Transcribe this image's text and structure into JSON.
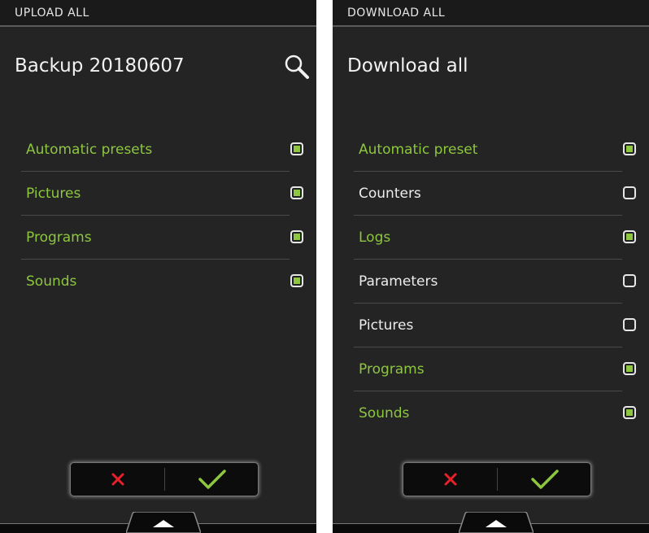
{
  "left": {
    "topbar_title": "UPLOAD ALL",
    "heading": "Backup 20180607",
    "search_icon": "search-icon",
    "items": [
      {
        "label": "Automatic presets",
        "checked": true
      },
      {
        "label": "Pictures",
        "checked": true
      },
      {
        "label": "Programs",
        "checked": true
      },
      {
        "label": "Sounds",
        "checked": true
      }
    ]
  },
  "right": {
    "topbar_title": "DOWNLOAD ALL",
    "heading": "Download all",
    "items": [
      {
        "label": "Automatic preset",
        "checked": true
      },
      {
        "label": "Counters",
        "checked": false
      },
      {
        "label": "Logs",
        "checked": true
      },
      {
        "label": "Parameters",
        "checked": false
      },
      {
        "label": "Pictures",
        "checked": false
      },
      {
        "label": "Programs",
        "checked": true
      },
      {
        "label": "Sounds",
        "checked": true
      }
    ]
  },
  "actions": {
    "cancel_icon": "close-icon",
    "confirm_icon": "check-icon"
  },
  "colors": {
    "accent_green": "#8dc63f",
    "cancel_red": "#e8202a",
    "panel_bg": "#242424"
  }
}
